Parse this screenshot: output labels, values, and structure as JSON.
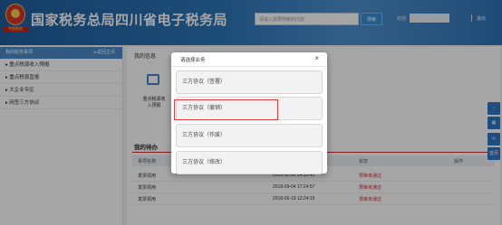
{
  "header": {
    "emblem_text": "中国税务",
    "title": "国家税务总局四川省电子税务局",
    "search_placeholder": "请输入需要搜索的内容",
    "search_button": "搜索",
    "welcome": "欢迎",
    "logout": "退出"
  },
  "sidebar": {
    "title": "我的服务事项",
    "back": "◂ 返回主页",
    "items": [
      {
        "label": "▸ 重点税源收入预报"
      },
      {
        "label": "▸ 重点税源直报"
      },
      {
        "label": "▸ 大企业专区"
      },
      {
        "label": "▸ 网签三方协议"
      }
    ]
  },
  "main": {
    "info_title": "我的信息",
    "info_label": "重点税源收入预报",
    "todo_title": "我的待办",
    "columns": {
      "name": "事项名称",
      "time": "",
      "status": "状态",
      "action": "操作"
    },
    "rows": [
      {
        "name": "发票领用",
        "time": "2018-11-06 14:35:45",
        "status": "预审未通过"
      },
      {
        "name": "发票领用",
        "time": "2018-09-04 17:24:57",
        "status": "预审未通过"
      },
      {
        "name": "发票领用",
        "time": "2018-06-19 12:24:15",
        "status": "预审未通过"
      }
    ]
  },
  "tools": [
    "↑",
    "▦",
    "✎",
    "首页"
  ],
  "modal": {
    "title": "请选择业务",
    "close": "×",
    "options": [
      {
        "label": "三方协议（签署）"
      },
      {
        "label": "三方协议（撤销）"
      },
      {
        "label": "三方协议（作废）"
      },
      {
        "label": "三方协议（修改）"
      }
    ]
  },
  "colors": {
    "header": "#2d76b9",
    "accent": "#4a8bc6",
    "highlight": "#e03b3b",
    "status_red": "#dd2222"
  },
  "icons": [
    "national-emblem-icon",
    "document-icon",
    "arrow-up-icon",
    "grid-icon",
    "edit-icon",
    "close-icon"
  ]
}
